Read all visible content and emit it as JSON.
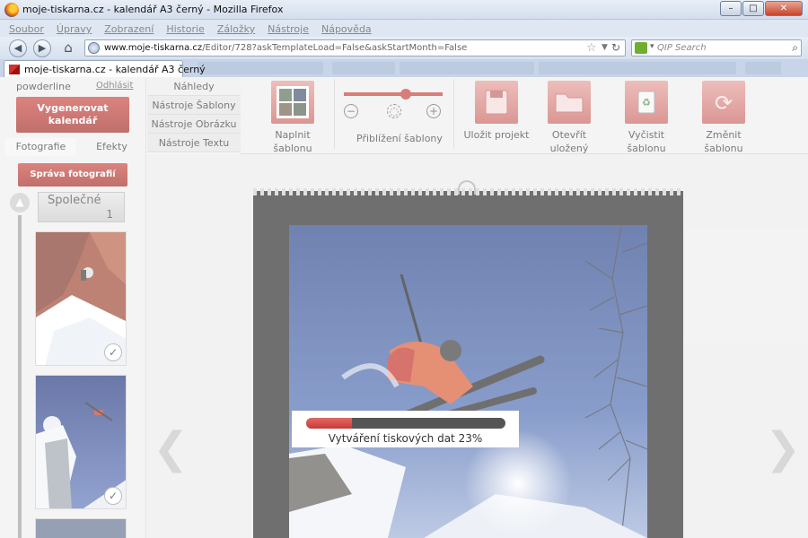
{
  "window": {
    "title": "moje-tiskarna.cz - kalendář A3 černý - Mozilla Firefox",
    "buttons": [
      "–",
      "□",
      "✕"
    ]
  },
  "menu": [
    "Soubor",
    "Úpravy",
    "Zobrazení",
    "Historie",
    "Záložky",
    "Nástroje",
    "Nápověda"
  ],
  "address": {
    "host": "www.moje-tiskarna.cz",
    "path": "/Editor/728?askTemplateLoad=False&askStartMonth=False"
  },
  "search": {
    "placeholder": "QIP Search"
  },
  "tab": {
    "label": "moje-tiskarna.cz - kalendář A3 černý"
  },
  "user": {
    "name": "powderline",
    "logout": "Odhlásit"
  },
  "left": {
    "generate": "Vygenerovat kalendář",
    "tabs": [
      "Fotografie",
      "Efekty"
    ],
    "manage_photos": "Správa fotografií",
    "album": {
      "label": "Společné",
      "count": "1"
    }
  },
  "side_tabs": [
    "Náhledy",
    "Nástroje Šablony",
    "Nástroje Obrázku",
    "Nástroje Textu"
  ],
  "toolbar": {
    "fill": "Naplnit šablonu obrázky",
    "zoom_label": "Přiblížení šablony",
    "zoom_level": 0.6,
    "save": "Uložit projekt",
    "open": "Otevřít uložený projekt",
    "clear": "Vyčistit šablonu",
    "change": "Změnit šablonu"
  },
  "progress": {
    "text": "Vytváření tiskových dat 23%",
    "value": 23
  },
  "colors": {
    "accent": "#c23a35",
    "accent_light": "#e39b97"
  }
}
